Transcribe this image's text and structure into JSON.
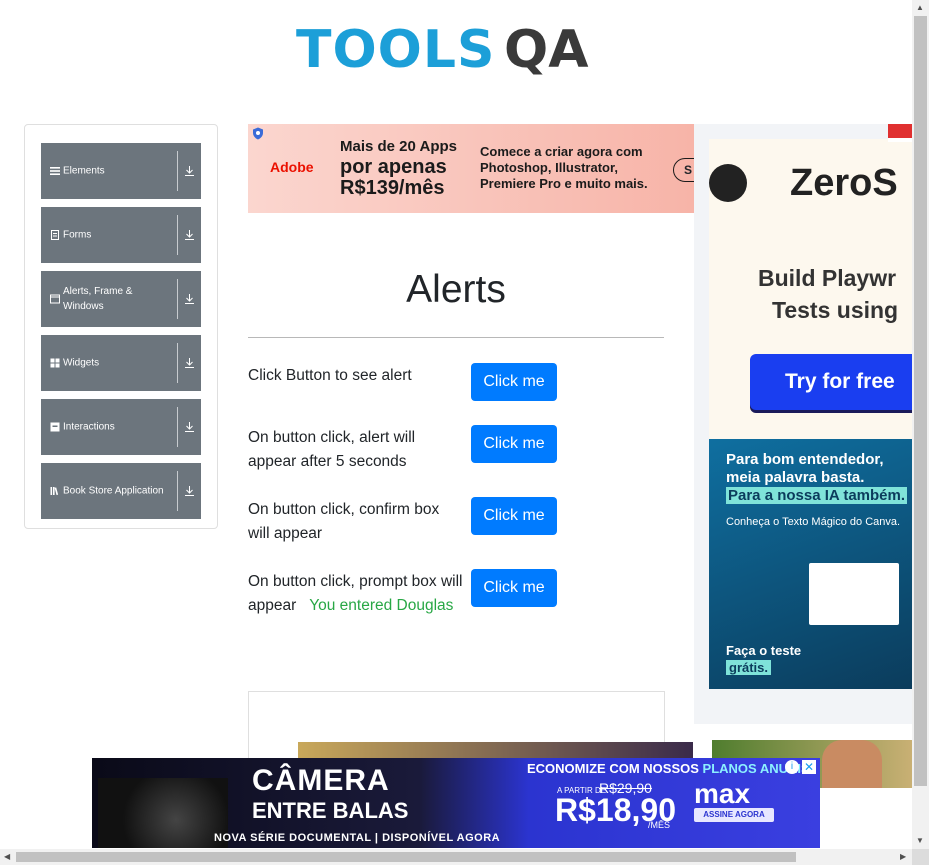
{
  "logo": {
    "part1": "TOOLS",
    "part2": "QA"
  },
  "sidebar": {
    "groups": [
      {
        "label": "Elements",
        "icon": "menu-icon"
      },
      {
        "label": "Forms",
        "icon": "form-icon"
      },
      {
        "label": "Alerts, Frame & Windows",
        "icon": "window-icon"
      },
      {
        "label": "Widgets",
        "icon": "widgets-icon"
      },
      {
        "label": "Interactions",
        "icon": "interactions-icon"
      },
      {
        "label": "Book Store Application",
        "icon": "book-icon"
      }
    ]
  },
  "main": {
    "title": "Alerts",
    "rows": [
      {
        "label": "Click Button to see alert",
        "button": "Click me"
      },
      {
        "label": "On button click, alert will appear after 5 seconds",
        "button": "Click me"
      },
      {
        "label": "On button click, confirm box will appear",
        "button": "Click me"
      },
      {
        "label": "On button click, prompt box will appear",
        "result": "You entered Douglas",
        "button": "Click me"
      }
    ]
  },
  "ads": {
    "adobe": {
      "brand": "Adobe",
      "headline_1": "Mais de 20 Apps",
      "headline_2": "por apenas",
      "headline_3": "R$139/mês",
      "body_1": "Comece a criar agora com",
      "body_2": "Photoshop, Illustrator,",
      "body_3": "Premiere Pro e muito mais.",
      "cta": "S"
    },
    "zerostep": {
      "brand": "ZeroS",
      "line1": "Build Playwr",
      "line2": "Tests using",
      "button": "Try for free"
    },
    "canva": {
      "line1": "Para bom entendedor,",
      "line2": "meia palavra basta.",
      "highlight": "Para a nossa IA também.",
      "sub": "Conheça o Texto Mágico do Canva.",
      "cta1": "Faça o teste",
      "cta2": "grátis."
    },
    "max": {
      "title1": "CÂMERA",
      "title2": "ENTRE BALAS",
      "tagline": "NOVA SÉRIE DOCUMENTAL | DISPONÍVEL AGORA",
      "economize": "ECONOMIZE COM NOSSOS",
      "economize_hl": "PLANOS ANUAIS",
      "a_partir": "A PARTIR DE",
      "old_price": "R$29,90",
      "price": "R$18,90",
      "per": "/MÊS",
      "brand": "max",
      "subscribe": "ASSINE AGORA"
    }
  },
  "colors": {
    "primary": "#007bff",
    "sidebar_group": "#6c757d",
    "result_green": "#28a745",
    "logo_blue": "#1c9fd8"
  }
}
